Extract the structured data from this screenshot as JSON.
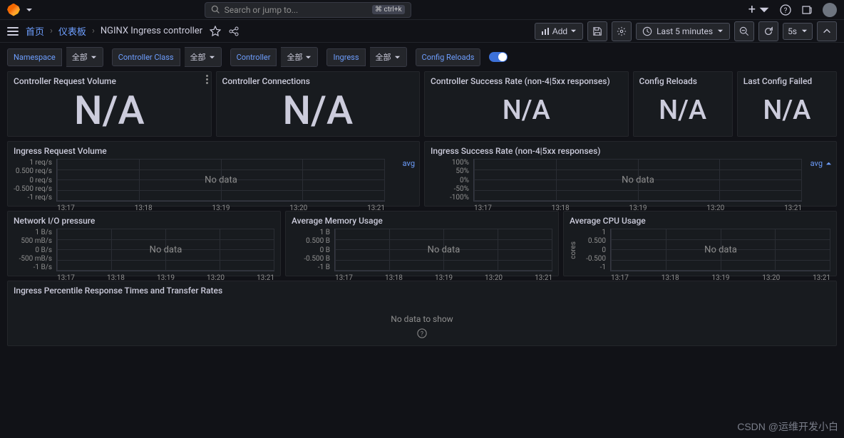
{
  "topbar": {
    "search_placeholder": "Search or jump to...",
    "shortcut": "ctrl+k"
  },
  "breadcrumb": {
    "home": "首页",
    "dashboards": "仪表板",
    "current": "NGINX Ingress controller"
  },
  "toolbar": {
    "add": "Add",
    "time": "Last 5 minutes",
    "refresh": "5s"
  },
  "filters": {
    "namespace_label": "Namespace",
    "namespace_val": "全部",
    "class_label": "Controller Class",
    "class_val": "全部",
    "controller_label": "Controller",
    "controller_val": "全部",
    "ingress_label": "Ingress",
    "ingress_val": "全部",
    "reloads_label": "Config Reloads"
  },
  "panels": {
    "ctrl_req_vol": {
      "title": "Controller Request Volume",
      "value": "N/A"
    },
    "ctrl_conn": {
      "title": "Controller Connections",
      "value": "N/A"
    },
    "ctrl_succ": {
      "title": "Controller Success Rate (non-4|5xx responses)",
      "value": "N/A"
    },
    "reloads": {
      "title": "Config Reloads",
      "value": "N/A"
    },
    "last_fail": {
      "title": "Last Config Failed",
      "value": "N/A"
    },
    "ing_req_vol": {
      "title": "Ingress Request Volume",
      "legend": "avg",
      "no_data": "No data"
    },
    "ing_succ": {
      "title": "Ingress Success Rate (non-4|5xx responses)",
      "legend": "avg",
      "no_data": "No data"
    },
    "net_io": {
      "title": "Network I/O pressure",
      "no_data": "No data"
    },
    "mem": {
      "title": "Average Memory Usage",
      "no_data": "No data"
    },
    "cpu": {
      "title": "Average CPU Usage",
      "no_data": "No data",
      "ylabel": "cores"
    },
    "percentile": {
      "title": "Ingress Percentile Response Times and Transfer Rates",
      "no_data": "No data to show"
    }
  },
  "axes": {
    "req": [
      "1 req/s",
      "0.500 req/s",
      "0 req/s",
      "-0.500 req/s",
      "-1 req/s"
    ],
    "pct": [
      "100%",
      "50%",
      "0%",
      "-50%",
      "-100%"
    ],
    "bps": [
      "1 B/s",
      "500 mB/s",
      "0 B/s",
      "-500 mB/s",
      "-1 B/s"
    ],
    "bytes": [
      "1 B",
      "0.500 B",
      "0 B",
      "-0.500 B",
      "-1 B"
    ],
    "cores": [
      "1",
      "0.500",
      "0",
      "-0.500",
      "-1"
    ],
    "time": [
      "13:17",
      "13:18",
      "13:19",
      "13:20",
      "13:21"
    ]
  },
  "watermark": "CSDN @运维开发小白"
}
